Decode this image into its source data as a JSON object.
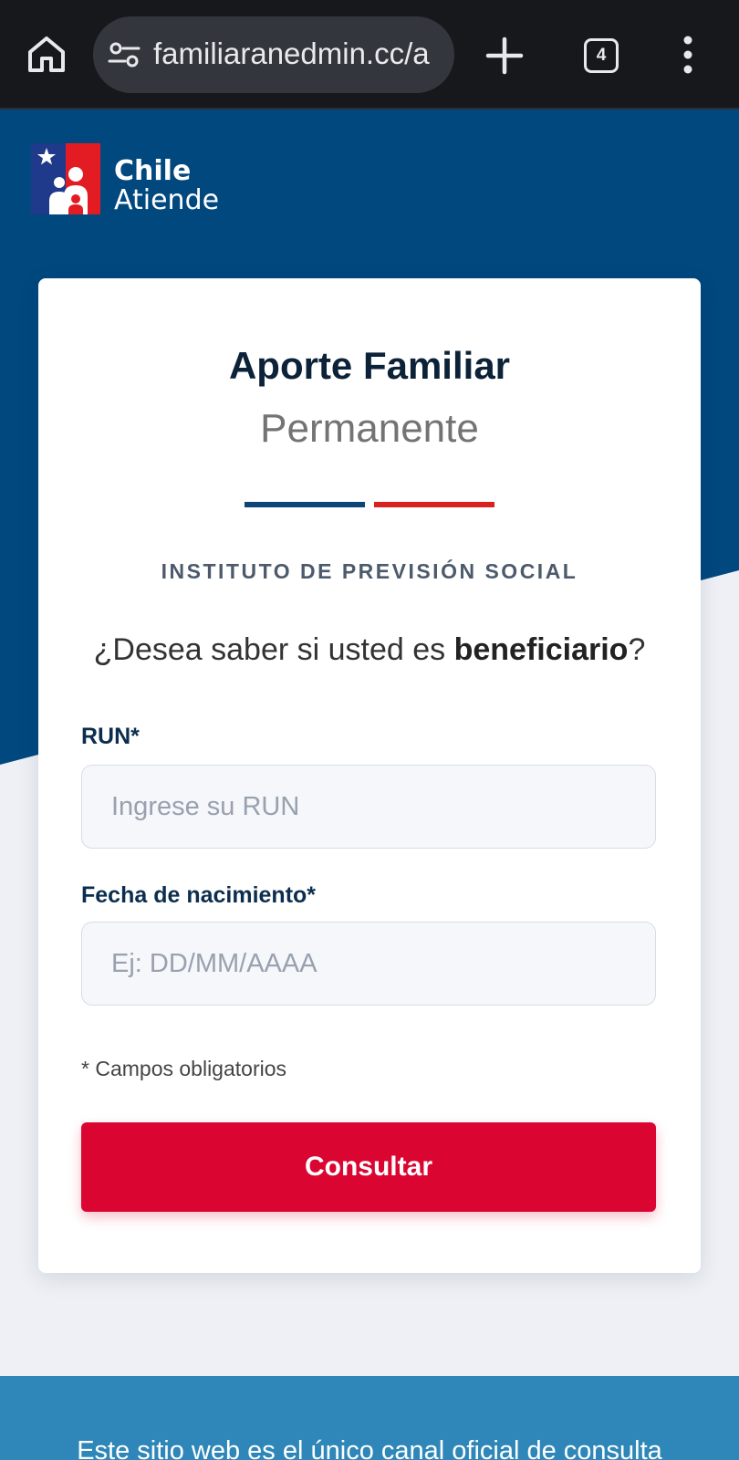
{
  "browser": {
    "url": "familiaranedmin.cc/a",
    "tab_count": "4",
    "icons": [
      "home-icon",
      "site-settings-icon",
      "plus-icon",
      "tab-switcher-icon",
      "more-vert-icon"
    ]
  },
  "brand": {
    "name_line1": "Chile",
    "name_line2": "Atiende"
  },
  "card": {
    "title": "Aporte Familiar",
    "subtitle": "Permanente",
    "institute": "INSTITUTO DE PREVISIÓN SOCIAL",
    "question_prefix": "¿Desea saber si usted es ",
    "question_bold": "beneficiario",
    "question_suffix": "?"
  },
  "form": {
    "run_label": "RUN*",
    "run_placeholder": "Ingrese su RUN",
    "run_value": "",
    "birth_label": "Fecha de nacimiento*",
    "birth_placeholder": "Ej: DD/MM/AAAA",
    "birth_value": "",
    "required_note": "* Campos obligatorios",
    "submit_label": "Consultar"
  },
  "footer": {
    "text": "Este sitio web es el único canal oficial de consulta"
  },
  "colors": {
    "hero_blue": "#01487f",
    "accent_red": "#da0530",
    "divider_blue": "#0d4578",
    "divider_red": "#d9211f",
    "footer_blue": "#2e87b8"
  }
}
